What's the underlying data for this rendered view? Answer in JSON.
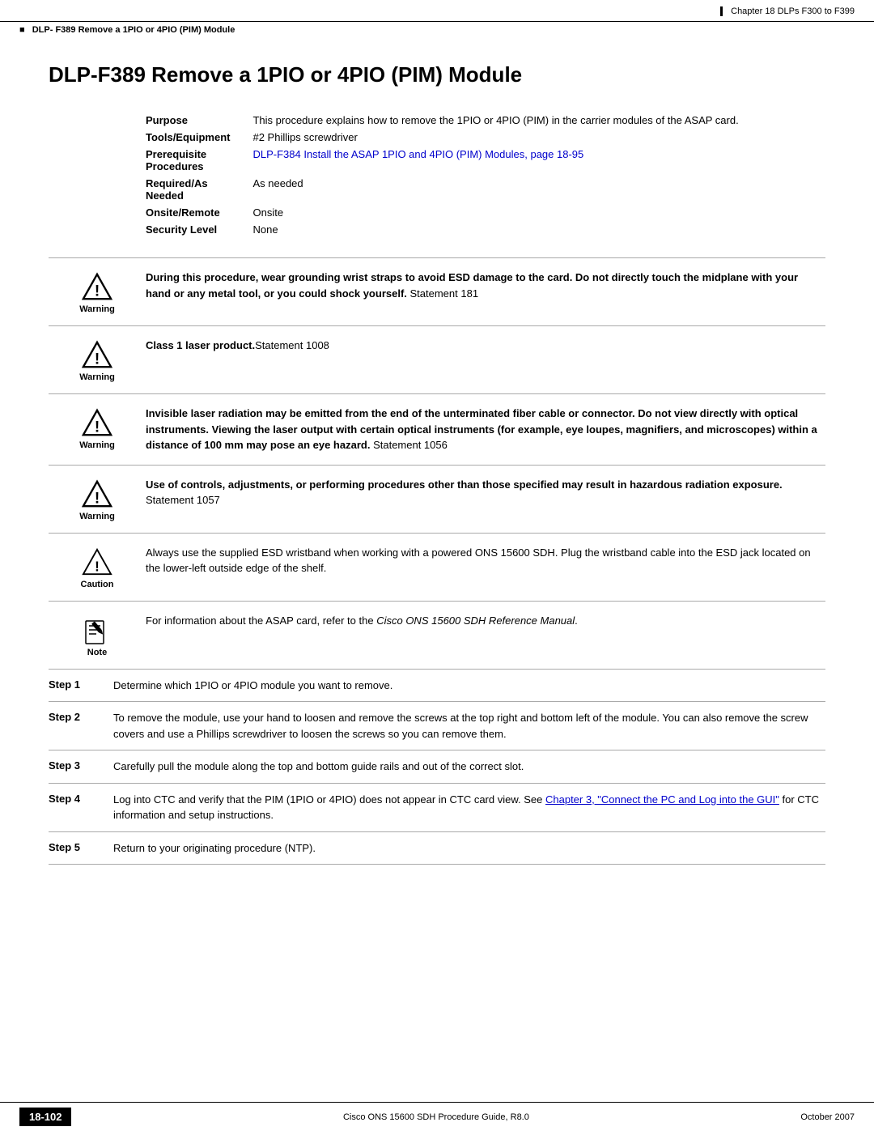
{
  "header": {
    "right_text": "Chapter 18 DLPs F300 to F399"
  },
  "breadcrumb": {
    "text": "DLP- F389 Remove a 1PIO or 4PIO (PIM) Module"
  },
  "page_title": "DLP-F389 Remove a 1PIO or 4PIO (PIM) Module",
  "info_rows": [
    {
      "label": "Purpose",
      "value": "This procedure explains how to remove the 1PIO or 4PIO (PIM) in the carrier modules of the ASAP card.",
      "link": null
    },
    {
      "label": "Tools/Equipment",
      "value": "#2 Phillips screwdriver",
      "link": null
    },
    {
      "label": "Prerequisite Procedures",
      "value": "DLP-F384 Install the ASAP 1PIO and 4PIO (PIM) Modules, page 18-95",
      "link": true
    },
    {
      "label": "Required/As Needed",
      "value": "As needed",
      "link": null
    },
    {
      "label": "Onsite/Remote",
      "value": "Onsite",
      "link": null
    },
    {
      "label": "Security Level",
      "value": "None",
      "link": null
    }
  ],
  "notices": [
    {
      "type": "warning",
      "label": "Warning",
      "text_html": "<b>During this procedure, wear grounding wrist straps to avoid ESD damage to the card. Do not directly touch the midplane with your hand or any metal tool, or you could shock yourself.</b> Statement 181"
    },
    {
      "type": "warning",
      "label": "Warning",
      "text_html": "<b>Class 1 laser product.</b>Statement 1008"
    },
    {
      "type": "warning",
      "label": "Warning",
      "text_html": "<b>Invisible laser radiation may be emitted from the end of the unterminated fiber cable or connector. Do not view directly with optical instruments. Viewing the laser output with certain optical instruments (for example, eye loupes, magnifiers, and microscopes) within a distance of 100 mm may pose an eye hazard.</b> Statement 1056"
    },
    {
      "type": "warning",
      "label": "Warning",
      "text_html": "<b>Use of controls, adjustments, or performing procedures other than those specified may result in hazardous radiation exposure.</b> Statement 1057"
    },
    {
      "type": "caution",
      "label": "Caution",
      "text_html": "Always use the supplied ESD wristband when working with a powered ONS 15600 SDH. Plug the wristband cable into the ESD jack located on the lower-left outside edge of the shelf."
    },
    {
      "type": "note",
      "label": "Note",
      "text_html": "For information about the ASAP card, refer to the <i>Cisco ONS 15600 SDH Reference Manual</i>."
    }
  ],
  "steps": [
    {
      "label": "Step 1",
      "text_html": "Determine which 1PIO or 4PIO module you want to remove."
    },
    {
      "label": "Step 2",
      "text_html": "To remove the module, use your hand to loosen and remove the screws at the top right and bottom left of the module. You can also remove the screw covers and use a Phillips screwdriver to loosen the screws so you can remove them."
    },
    {
      "label": "Step 3",
      "text_html": "Carefully pull the module along the top and bottom guide rails and out of the correct slot."
    },
    {
      "label": "Step 4",
      "text_html": "Log into CTC and verify that the PIM (1PIO or 4PIO) does not appear in CTC card view. See <a href=\"#\" style=\"color:#0000cc\">Chapter 3, \"Connect the PC and Log into the GUI\"</a> for CTC information and setup instructions."
    },
    {
      "label": "Step 5",
      "text_html": "Return to your originating procedure (NTP)."
    }
  ],
  "footer": {
    "page_badge": "18-102",
    "center_text": "Cisco ONS 15600 SDH Procedure Guide, R8.0",
    "right_text": "October 2007"
  }
}
